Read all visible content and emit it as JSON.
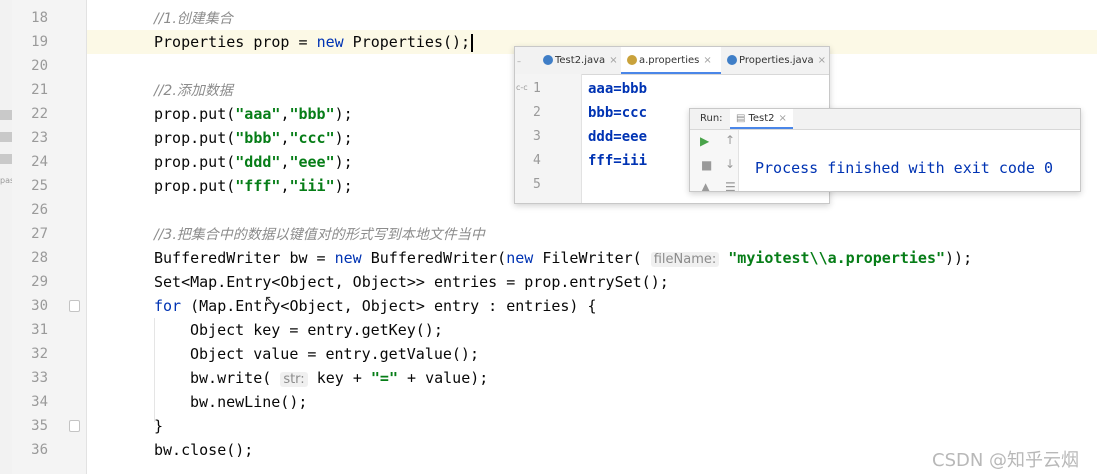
{
  "editor": {
    "lines": [
      {
        "num": "18",
        "segments": [
          {
            "cls": "cm",
            "text": "//1.创建集合"
          }
        ]
      },
      {
        "num": "19",
        "current": true,
        "caret": true,
        "segments": [
          {
            "text": "Properties prop = "
          },
          {
            "cls": "kw",
            "text": "new"
          },
          {
            "text": " Properties();"
          }
        ]
      },
      {
        "num": "20",
        "segments": []
      },
      {
        "num": "21",
        "segments": [
          {
            "cls": "cm",
            "text": "//2.添加数据"
          }
        ]
      },
      {
        "num": "22",
        "segments": [
          {
            "text": "prop.put("
          },
          {
            "cls": "str",
            "text": "\"aaa\""
          },
          {
            "text": ","
          },
          {
            "cls": "str",
            "text": "\"bbb\""
          },
          {
            "text": ");"
          }
        ]
      },
      {
        "num": "23",
        "segments": [
          {
            "text": "prop.put("
          },
          {
            "cls": "str",
            "text": "\"bbb\""
          },
          {
            "text": ","
          },
          {
            "cls": "str",
            "text": "\"ccc\""
          },
          {
            "text": ");"
          }
        ]
      },
      {
        "num": "24",
        "segments": [
          {
            "text": "prop.put("
          },
          {
            "cls": "str",
            "text": "\"ddd\""
          },
          {
            "text": ","
          },
          {
            "cls": "str",
            "text": "\"eee\""
          },
          {
            "text": ");"
          }
        ]
      },
      {
        "num": "25",
        "segments": [
          {
            "text": "prop.put("
          },
          {
            "cls": "str",
            "text": "\"fff\""
          },
          {
            "text": ","
          },
          {
            "cls": "str",
            "text": "\"iii\""
          },
          {
            "text": ");"
          }
        ]
      },
      {
        "num": "26",
        "segments": []
      },
      {
        "num": "27",
        "segments": [
          {
            "cls": "cm",
            "text": "//3.把集合中的数据以键值对的形式写到本地文件当中"
          }
        ]
      },
      {
        "num": "28",
        "segments": [
          {
            "text": "BufferedWriter bw = "
          },
          {
            "cls": "kw",
            "text": "new"
          },
          {
            "text": " BufferedWriter("
          },
          {
            "cls": "kw",
            "text": "new"
          },
          {
            "text": " FileWriter( "
          },
          {
            "cls": "hint",
            "text": "fileName:"
          },
          {
            "text": " "
          },
          {
            "cls": "str",
            "text": "\"myiotest\\\\a.properties\""
          },
          {
            "text": "));"
          }
        ]
      },
      {
        "num": "29",
        "segments": [
          {
            "text": "Set<Map.Entry<Object, Object>> entries = prop.entrySet();"
          }
        ]
      },
      {
        "num": "30",
        "fold": true,
        "segments": [
          {
            "cls": "kw",
            "text": "for"
          },
          {
            "text": " (Map.Entry<Object, Object> entry : entries) {"
          }
        ]
      },
      {
        "num": "31",
        "indent": 1,
        "segments": [
          {
            "text": "Object key = entry.getKey();"
          }
        ]
      },
      {
        "num": "32",
        "indent": 1,
        "segments": [
          {
            "text": "Object value = entry.getValue();"
          }
        ]
      },
      {
        "num": "33",
        "indent": 1,
        "segments": [
          {
            "text": "bw.write( "
          },
          {
            "cls": "hint",
            "text": "str:"
          },
          {
            "text": " key + "
          },
          {
            "cls": "str",
            "text": "\"=\""
          },
          {
            "text": " + value);"
          }
        ]
      },
      {
        "num": "34",
        "indent": 1,
        "segments": [
          {
            "text": "bw.newLine();"
          }
        ]
      },
      {
        "num": "35",
        "fold": true,
        "segments": [
          {
            "text": "}"
          }
        ]
      },
      {
        "num": "36",
        "segments": [
          {
            "text": "bw.close();"
          }
        ]
      }
    ]
  },
  "left_strip": {
    "text": "pas"
  },
  "props_window": {
    "tabs": [
      {
        "label": "Test2.java",
        "icon_color": "#3f7ec7",
        "icon": "class-icon"
      },
      {
        "label": "a.properties",
        "icon_color": "#c9a23b",
        "icon": "properties-file-icon"
      },
      {
        "label": "Properties.java",
        "icon_color": "#3f7ec7",
        "icon": "class-icon"
      }
    ],
    "side_marks": [
      "–",
      "c-c"
    ],
    "lines": [
      {
        "num": "1",
        "text": "aaa=bbb"
      },
      {
        "num": "2",
        "text": "bbb=ccc"
      },
      {
        "num": "3",
        "text": "ddd=eee"
      },
      {
        "num": "4",
        "text": "fff=iii"
      },
      {
        "num": "5",
        "text": ""
      }
    ]
  },
  "run_panel": {
    "label": "Run:",
    "tab": "Test2",
    "output": "Process finished with exit code 0"
  },
  "watermark": "CSDN @知乎云烟"
}
